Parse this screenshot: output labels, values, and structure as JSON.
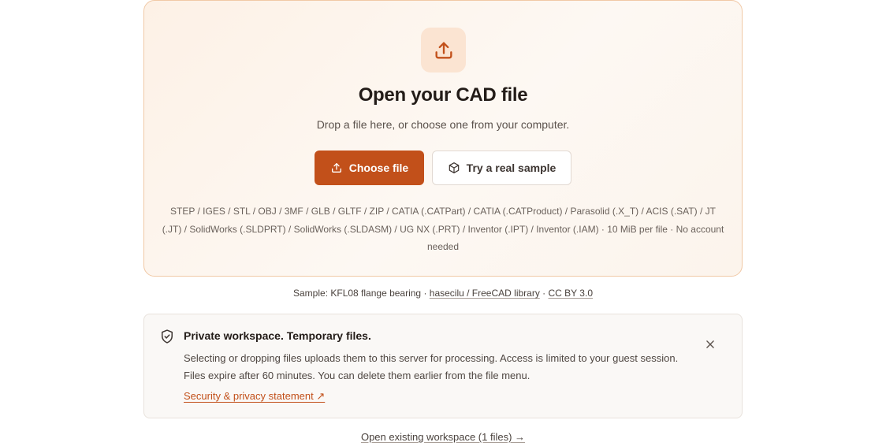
{
  "dropzone": {
    "icon": "upload-icon",
    "title": "Open your CAD file",
    "subtitle": "Drop a file here, or choose one from your computer.",
    "choose_file_label": "Choose file",
    "sample_button_label": "Try a real sample",
    "formats": "STEP / IGES / STL / OBJ / 3MF / GLB / GLTF / ZIP / CATIA (.CATPart) / CATIA (.CATProduct) / Parasolid (.X_T) / ACIS (.SAT) / JT (.JT) / SolidWorks (.SLDPRT) / SolidWorks (.SLDASM) / UG NX (.PRT) / Inventor (.IPT) / Inventor (.IAM) · 10 MiB per file · No account needed"
  },
  "sample": {
    "prefix": "Sample: KFL08 flange bearing ·",
    "source_link": "hasecilu / FreeCAD library",
    "separator": "·",
    "license_link": "CC BY 3.0"
  },
  "notice": {
    "icon": "shield-check-icon",
    "title": "Private workspace. Temporary files.",
    "body": "Selecting or dropping files uploads them to this server for processing. Access is limited to your guest session. Files expire after 60 minutes. You can delete them earlier from the file menu.",
    "link_label": "Security & privacy statement ↗"
  },
  "workspace_link": "Open existing workspace (1 files) →",
  "colors": {
    "accent": "#c2501a",
    "dropzone_border": "#f1c9a6",
    "badge_bg": "#fbe4d2"
  }
}
